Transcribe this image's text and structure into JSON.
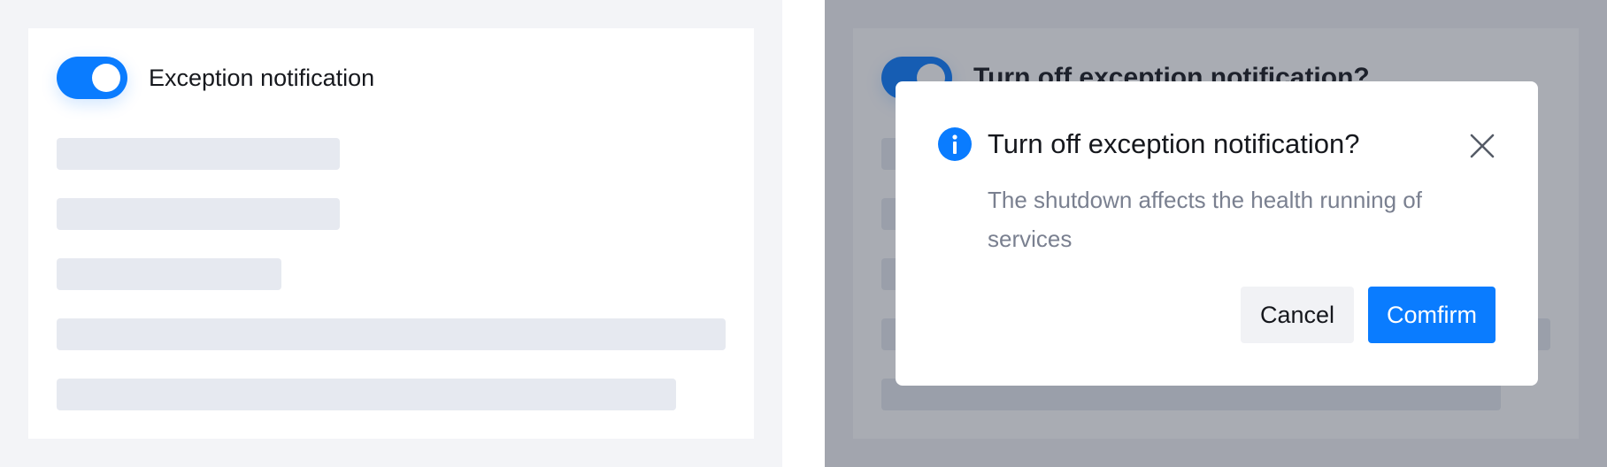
{
  "left_panel": {
    "toggle": {
      "state": "on",
      "color": "#0a7cff"
    },
    "label": "Exception notification"
  },
  "right_panel": {
    "background_label": "Turn off exception notification?",
    "dialog": {
      "icon": "info-icon",
      "title": "Turn off exception notification?",
      "description": "The shutdown affects the health running of services",
      "close_icon": "close-icon",
      "cancel_label": "Cancel",
      "confirm_label": "Comfirm"
    }
  },
  "colors": {
    "primary": "#0a7cff",
    "page_bg": "#f3f4f7",
    "skeleton": "#e6e9f0",
    "overlay": "rgba(40,47,64,0.40)"
  }
}
